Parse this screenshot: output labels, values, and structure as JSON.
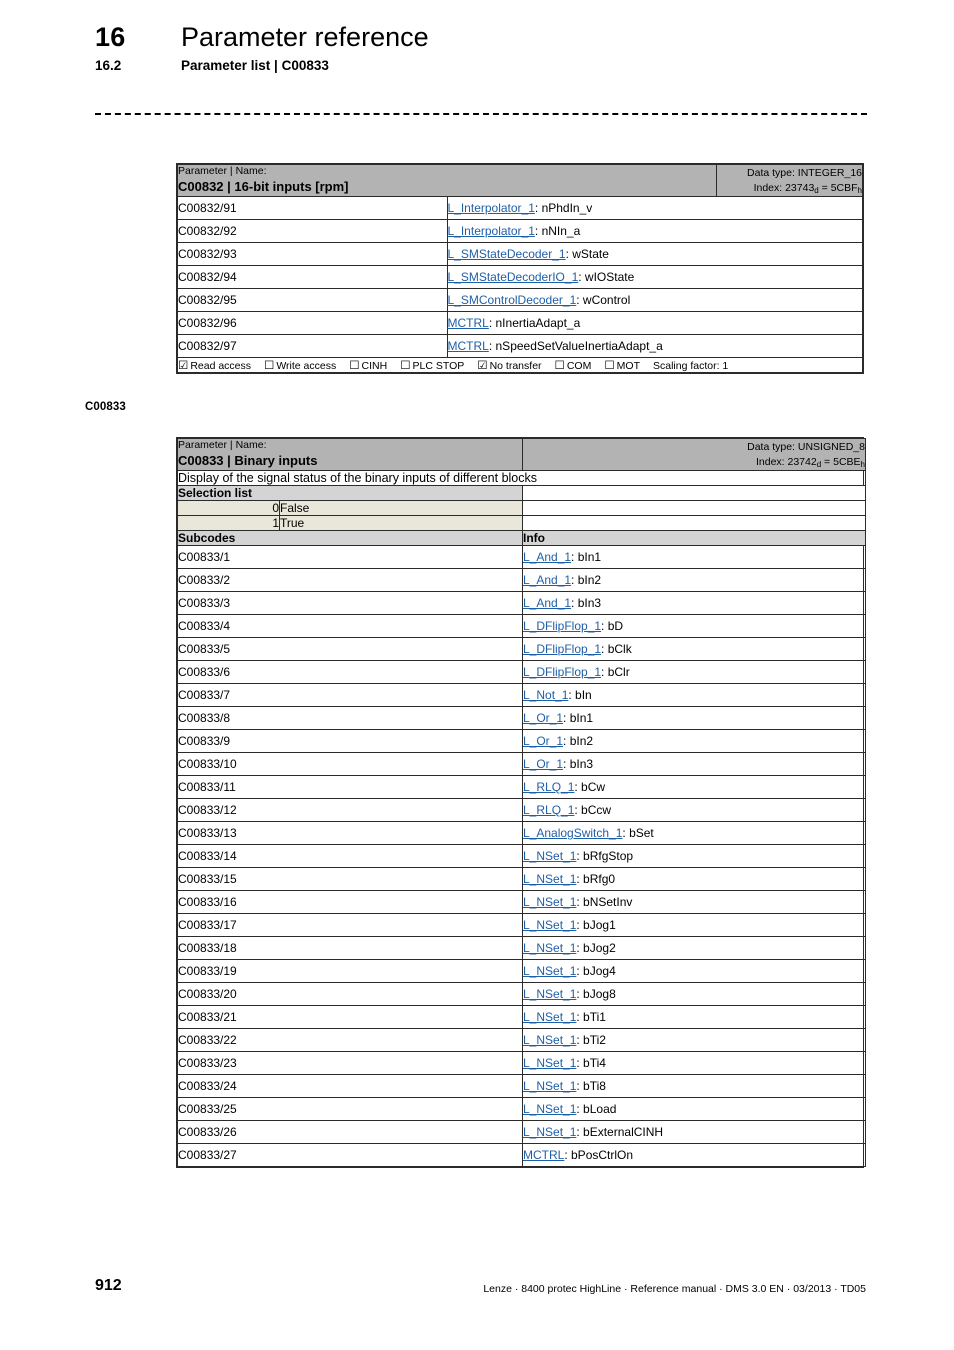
{
  "header": {
    "chapter_number": "16",
    "chapter_title": "Parameter reference",
    "section_number": "16.2",
    "section_title": "Parameter list | C00833"
  },
  "margin_notes": {
    "c00833": "C00833"
  },
  "table_c00832": {
    "kicker": "Parameter | Name:",
    "name": "C00832 | 16-bit inputs [rpm]",
    "data_type_label": "Data type: INTEGER_16",
    "index_label_prefix": "Index: 23743",
    "index_label_sub1": "d",
    "index_label_mid": " = 5CBF",
    "index_label_sub2": "h",
    "rows": [
      {
        "code": "C00832/91",
        "link": "L_Interpolator_1",
        "signal": ": nPhdIn_v"
      },
      {
        "code": "C00832/92",
        "link": "L_Interpolator_1",
        "signal": ": nNIn_a"
      },
      {
        "code": "C00832/93",
        "link": "L_SMStateDecoder_1",
        "signal": ": wState"
      },
      {
        "code": "C00832/94",
        "link": "L_SMStateDecoderIO_1",
        "signal": ": wIOState"
      },
      {
        "code": "C00832/95",
        "link": "L_SMControlDecoder_1",
        "signal": ": wControl"
      },
      {
        "code": "C00832/96",
        "link": "MCTRL",
        "signal": ": nInertiaAdapt_a"
      },
      {
        "code": "C00832/97",
        "link": "MCTRL",
        "signal": ": nSpeedSetValueInertiaAdapt_a"
      }
    ],
    "legend": [
      {
        "box": "☑",
        "label": "Read access"
      },
      {
        "box": "☐",
        "label": "Write access"
      },
      {
        "box": "☐",
        "label": "CINH"
      },
      {
        "box": "☐",
        "label": "PLC STOP"
      },
      {
        "box": "☑",
        "label": "No transfer"
      },
      {
        "box": "☐",
        "label": "COM"
      },
      {
        "box": "☐",
        "label": "MOT"
      }
    ],
    "scaling_factor": "Scaling factor: 1"
  },
  "table_c00833": {
    "kicker": "Parameter | Name:",
    "name": "C00833 | Binary inputs",
    "data_type_label": "Data type: UNSIGNED_8",
    "index_label_prefix": "Index: 23742",
    "index_label_sub1": "d",
    "index_label_mid": " = 5CBE",
    "index_label_sub2": "h",
    "description": "Display of the signal status of the binary inputs of different blocks",
    "selection_list_header": "Selection list",
    "selection_list": [
      {
        "value": "0",
        "label": "False"
      },
      {
        "value": "1",
        "label": "True"
      }
    ],
    "subcodes_header": "Subcodes",
    "info_header": "Info",
    "rows": [
      {
        "code": "C00833/1",
        "link": "L_And_1",
        "signal": ": bIn1"
      },
      {
        "code": "C00833/2",
        "link": "L_And_1",
        "signal": ": bIn2"
      },
      {
        "code": "C00833/3",
        "link": "L_And_1",
        "signal": ": bIn3"
      },
      {
        "code": "C00833/4",
        "link": "L_DFlipFlop_1",
        "signal": ": bD"
      },
      {
        "code": "C00833/5",
        "link": "L_DFlipFlop_1",
        "signal": ": bClk"
      },
      {
        "code": "C00833/6",
        "link": "L_DFlipFlop_1",
        "signal": ": bClr"
      },
      {
        "code": "C00833/7",
        "link": "L_Not_1",
        "signal": ": bIn"
      },
      {
        "code": "C00833/8",
        "link": "L_Or_1",
        "signal": ": bIn1"
      },
      {
        "code": "C00833/9",
        "link": "L_Or_1",
        "signal": ": bIn2"
      },
      {
        "code": "C00833/10",
        "link": "L_Or_1",
        "signal": ": bIn3"
      },
      {
        "code": "C00833/11",
        "link": "L_RLQ_1",
        "signal": ": bCw"
      },
      {
        "code": "C00833/12",
        "link": "L_RLQ_1",
        "signal": ": bCcw"
      },
      {
        "code": "C00833/13",
        "link": "L_AnalogSwitch_1",
        "signal": ": bSet"
      },
      {
        "code": "C00833/14",
        "link": "L_NSet_1",
        "signal": ": bRfgStop"
      },
      {
        "code": "C00833/15",
        "link": "L_NSet_1",
        "signal": ": bRfg0"
      },
      {
        "code": "C00833/16",
        "link": "L_NSet_1",
        "signal": ": bNSetInv"
      },
      {
        "code": "C00833/17",
        "link": "L_NSet_1",
        "signal": ": bJog1"
      },
      {
        "code": "C00833/18",
        "link": "L_NSet_1",
        "signal": ": bJog2"
      },
      {
        "code": "C00833/19",
        "link": "L_NSet_1",
        "signal": ": bJog4"
      },
      {
        "code": "C00833/20",
        "link": "L_NSet_1",
        "signal": ": bJog8"
      },
      {
        "code": "C00833/21",
        "link": "L_NSet_1",
        "signal": ": bTi1"
      },
      {
        "code": "C00833/22",
        "link": "L_NSet_1",
        "signal": ": bTi2"
      },
      {
        "code": "C00833/23",
        "link": "L_NSet_1",
        "signal": ": bTi4"
      },
      {
        "code": "C00833/24",
        "link": "L_NSet_1",
        "signal": ": bTi8"
      },
      {
        "code": "C00833/25",
        "link": "L_NSet_1",
        "signal": ": bLoad"
      },
      {
        "code": "C00833/26",
        "link": "L_NSet_1",
        "signal": ": bExternalCINH"
      },
      {
        "code": "C00833/27",
        "link": "MCTRL",
        "signal": ": bPosCtrlOn"
      }
    ]
  },
  "footer": {
    "page_number": "912",
    "imprint": "Lenze · 8400 protec HighLine · Reference manual · DMS 3.0 EN · 03/2013 · TD05"
  },
  "colors": {
    "title_band": "#b3b3b3",
    "section_header": "#d4d4d4",
    "selection_row": "#e9e7d9",
    "link": "#1f5fa8",
    "border": "#2b2b2b"
  }
}
